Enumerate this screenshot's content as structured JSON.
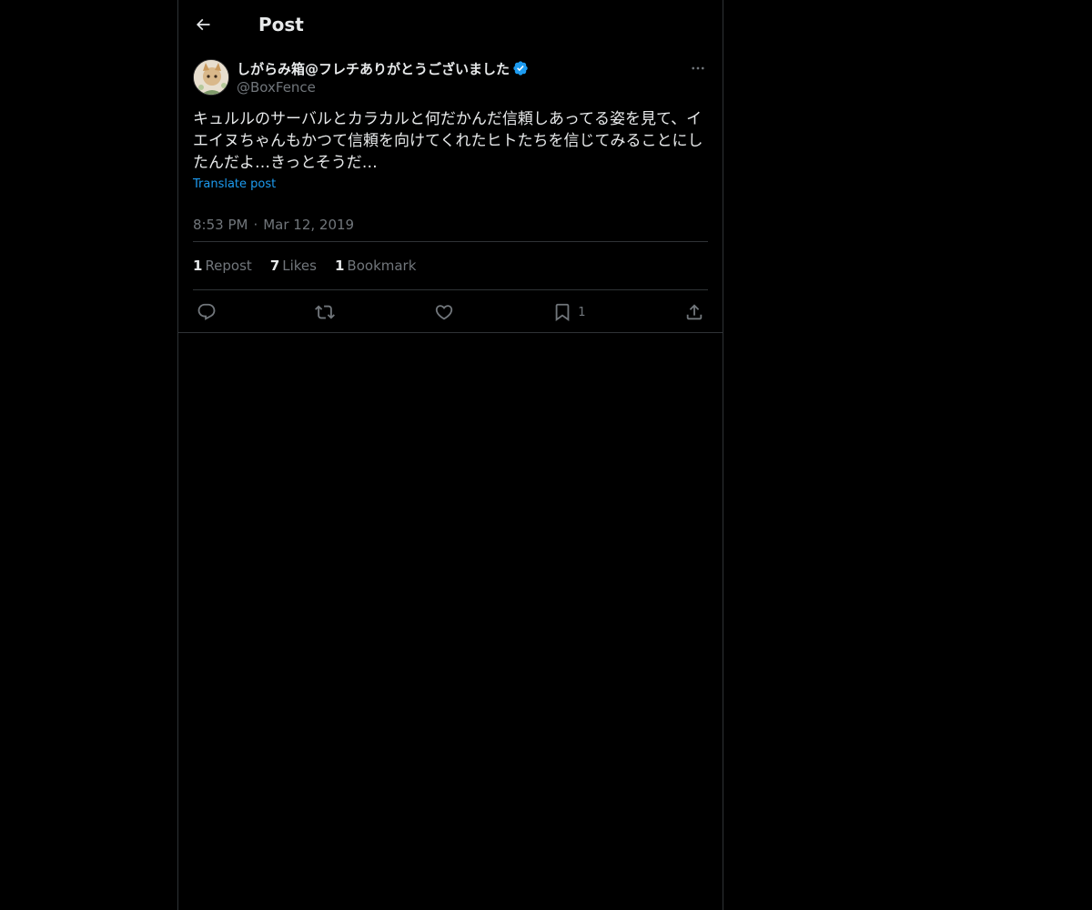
{
  "header": {
    "title": "Post",
    "back_icon": "arrow-left-icon"
  },
  "post": {
    "author": {
      "display_name": "しがらみ箱@フレチありがとうございました",
      "handle": "@BoxFence",
      "verified": true,
      "verified_color": "#1d9bf0"
    },
    "text": "キュルルのサーバルとカラカルと何だかんだ信頼しあってる姿を見て、イエイヌちゃんもかつて信頼を向けてくれたヒトたちを信じてみることにしたんだよ…きっとそうだ…",
    "translate_label": "Translate post",
    "time": "8:53 PM",
    "separator": "·",
    "date": "Mar 12, 2019",
    "stats": {
      "reposts_count": "1",
      "reposts_label": "Repost",
      "likes_count": "7",
      "likes_label": "Likes",
      "bookmarks_count": "1",
      "bookmarks_label": "Bookmark"
    },
    "actions": {
      "reply_icon": "reply-icon",
      "repost_icon": "repost-icon",
      "like_icon": "heart-icon",
      "bookmark_icon": "bookmark-icon",
      "bookmark_count": "1",
      "share_icon": "share-icon"
    }
  },
  "colors": {
    "background": "#000000",
    "text": "#e7e9ea",
    "secondary": "#71767b",
    "accent": "#1d9bf0",
    "border": "#2f3336"
  }
}
